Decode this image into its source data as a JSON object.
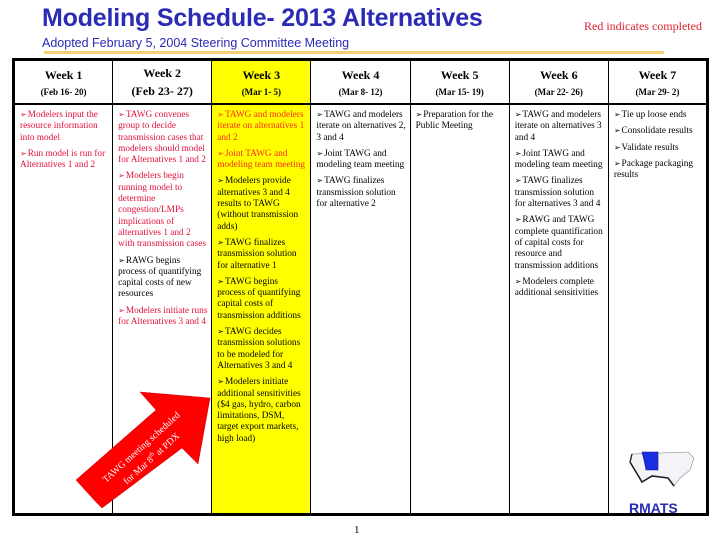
{
  "header": {
    "title": "Modeling Schedule- 2013 Alternatives",
    "subtitle": "Adopted February 5, 2004 Steering Committee Meeting",
    "legend_note": "Red indicates completed"
  },
  "colors": {
    "title": "#2b2bb5",
    "completed": "#e0103a",
    "highlight": "#ffff00",
    "arrow": "#ff0000",
    "underline": "#f3cf72"
  },
  "weeks": [
    {
      "label": "Week 1",
      "dates": "(Feb 16- 20)",
      "highlighted": false,
      "items": [
        {
          "text": "Modelers input the resource information into model",
          "completed": true
        },
        {
          "text": "Run model is run for Alternatives 1 and 2",
          "completed": true
        }
      ]
    },
    {
      "label": "Week 2",
      "dates": "(Feb 23- 27)",
      "highlighted": false,
      "items": [
        {
          "text": "TAWG convenes group to decide transmission cases that modelers should model for Alternatives 1 and 2",
          "completed": true
        },
        {
          "text": "Modelers begin running model to determine congestion/LMPs implications of alternatives 1 and 2 with transmission cases",
          "completed": true
        },
        {
          "text": "RAWG begins process of quantifying capital costs of new resources",
          "completed": false
        },
        {
          "text": "Modelers initiate runs for Alternatives 3 and 4",
          "completed": true
        }
      ]
    },
    {
      "label": "Week 3",
      "dates": "(Mar 1- 5)",
      "highlighted": true,
      "items": [
        {
          "text": "TAWG and modelers iterate on alternatives 1 and 2",
          "completed": true
        },
        {
          "text": "Joint TAWG and modeling team meeting",
          "completed": true
        },
        {
          "text": "Modelers provide alternatives 3 and 4 results to TAWG (without transmission adds)",
          "completed": false
        },
        {
          "text": "TAWG finalizes transmission solution for alternative 1",
          "completed": false
        },
        {
          "text": "TAWG begins process of quantifying capital costs of transmission additions",
          "completed": false
        },
        {
          "text": "TAWG decides transmission solutions to be modeled for Alternatives 3 and 4",
          "completed": false
        },
        {
          "text": "Modelers initiate additional sensitivities ($4 gas, hydro, carbon limitations, DSM, target export markets, high load)",
          "completed": false
        }
      ]
    },
    {
      "label": "Week 4",
      "dates": "(Mar 8- 12)",
      "highlighted": false,
      "items": [
        {
          "text": "TAWG and modelers iterate on alternatives 2, 3 and 4",
          "completed": false
        },
        {
          "text": "Joint TAWG and modeling team meeting",
          "completed": false
        },
        {
          "text": "TAWG finalizes transmission solution for alternative 2",
          "completed": false
        }
      ]
    },
    {
      "label": "Week 5",
      "dates": "(Mar 15- 19)",
      "highlighted": false,
      "items": [
        {
          "text": "Preparation for the Public Meeting",
          "completed": false
        }
      ]
    },
    {
      "label": "Week 6",
      "dates": "(Mar 22- 26)",
      "highlighted": false,
      "items": [
        {
          "text": "TAWG and modelers iterate on alternatives  3 and 4",
          "completed": false
        },
        {
          "text": "Joint TAWG and modeling team meeting",
          "completed": false
        },
        {
          "text": "TAWG finalizes transmission solution for alternatives 3 and 4",
          "completed": false
        },
        {
          "text": "RAWG and TAWG complete quantification of capital costs for resource and transmission additions",
          "completed": false
        },
        {
          "text": "Modelers complete additional sensitivities",
          "completed": false
        }
      ]
    },
    {
      "label": "Week 7",
      "dates": "(Mar 29- 2)",
      "highlighted": false,
      "items": [
        {
          "text": "Tie up loose ends",
          "completed": false
        },
        {
          "text": "Consolidate results",
          "completed": false
        },
        {
          "text": "Validate results",
          "completed": false
        },
        {
          "text": "Package packaging results",
          "completed": false
        }
      ]
    }
  ],
  "bullet_glyph": "➢",
  "callout": {
    "line1": "TAWG meeting scheduled",
    "line2_prefix": "for Mar 8",
    "line2_sup": "th",
    "line2_suffix": " at PDX"
  },
  "logo": {
    "icon": "us-map-icon",
    "text": "RMATS"
  },
  "page_number": "1"
}
